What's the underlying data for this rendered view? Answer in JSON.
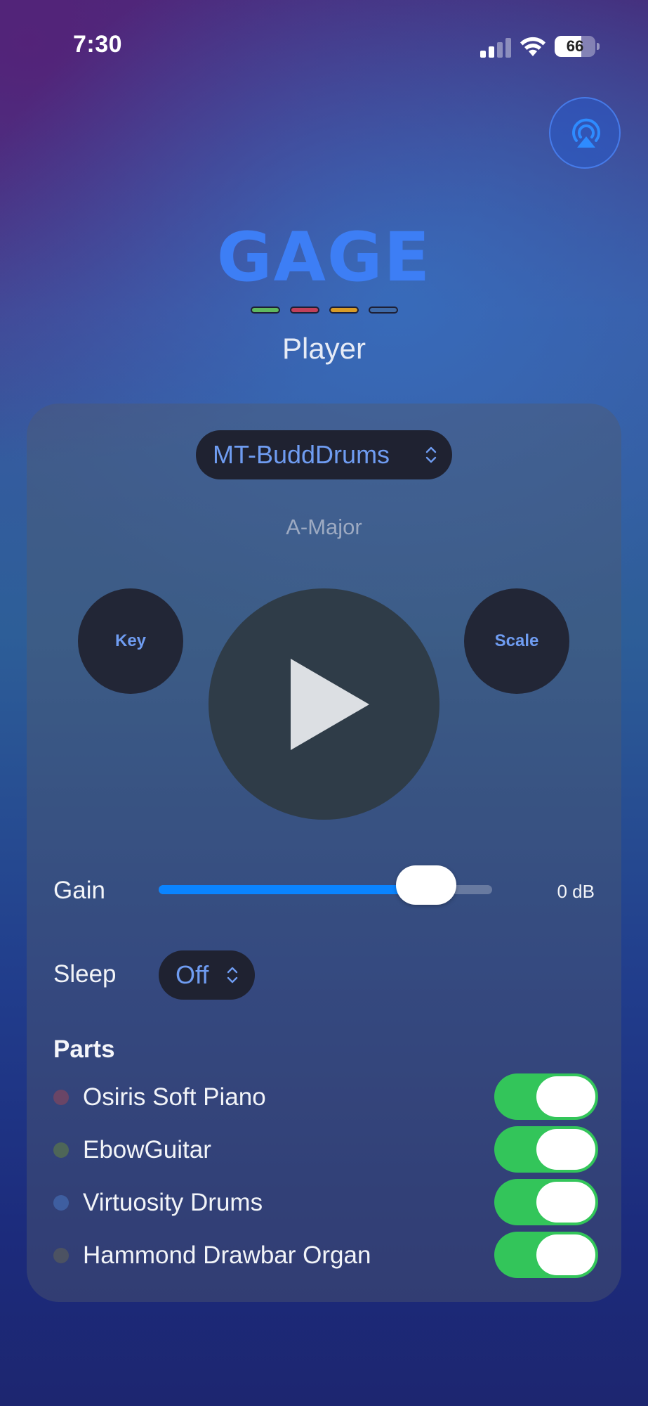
{
  "status_bar": {
    "time": "7:30",
    "battery_level": "66",
    "battery_fraction": 0.66
  },
  "header": {
    "airplay_icon": "airplay-audio-icon",
    "logo": "GAGE",
    "subtitle": "Player",
    "dash_colors": [
      "#5fb85f",
      "#c0405a",
      "#d89c28",
      "#3e6aa8"
    ]
  },
  "player": {
    "preset": "MT-BuddDrums",
    "key_scale": "A-Major",
    "key_label": "Key",
    "scale_label": "Scale",
    "play_icon": "play-icon"
  },
  "gain": {
    "label": "Gain",
    "value": "0 dB",
    "level": 0.87
  },
  "sleep": {
    "label": "Sleep",
    "value": "Off"
  },
  "parts": {
    "title": "Parts",
    "items": [
      {
        "name": "Osiris Soft Piano",
        "color": "#6a4566",
        "on": true
      },
      {
        "name": "EbowGuitar",
        "color": "#4e6658",
        "on": true
      },
      {
        "name": "Virtuosity Drums",
        "color": "#3e5ea0",
        "on": true
      },
      {
        "name": "Hammond Drawbar Organ",
        "color": "#4c5262",
        "on": true
      }
    ]
  },
  "colors": {
    "accent_blue": "#0a84ff",
    "toggle_green": "#33c55a",
    "pill_text": "#6f9cf1"
  }
}
